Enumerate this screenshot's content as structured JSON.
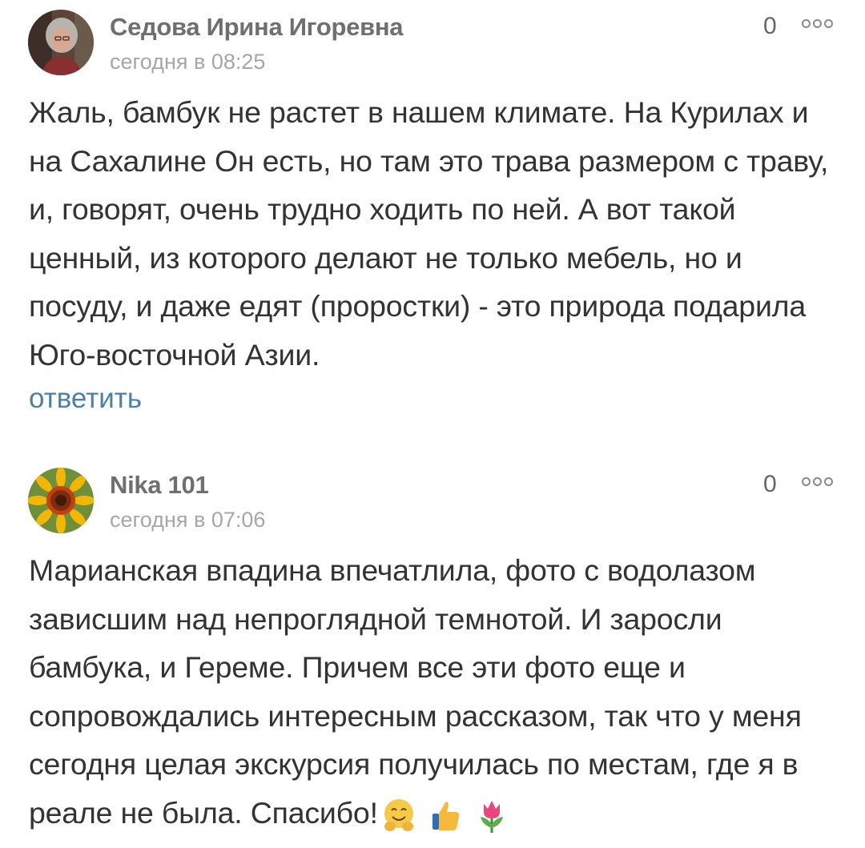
{
  "comments": [
    {
      "author": "Седова Ирина Игоревна",
      "timestamp": "сегодня в 08:25",
      "rating": "0",
      "text": "Жаль, бамбук не растет в нашем климате. На Курилах и на Сахалине Он есть, но там это трава размером с траву, и, говорят, очень трудно ходить по ней. А вот такой ценный, из которого делают не только мебель, но и посуду, и даже едят (проростки) - это природа подарила Юго-восточной Азии.",
      "reply_label": "ответить",
      "avatar_icon": "portrait-photo"
    },
    {
      "author": "Nika 101",
      "timestamp": "сегодня в 07:06",
      "rating": "0",
      "text": "Марианская впадина впечатлила, фото с водолазом зависшим над непроглядной темнотой. И заросли бамбука, и Гереме. Причем все эти фото еще и сопровождались интересным рассказом, так что у меня сегодня целая экскурсия получилась по местам, где я в реале не была. Спасибо!",
      "emojis": [
        "hugging-face-emoji",
        "thumbs-up-emoji",
        "tulip-emoji"
      ],
      "avatar_icon": "sunflower-photo"
    }
  ],
  "colors": {
    "author": "#6f6f6f",
    "timestamp": "#a6a6a6",
    "body_text": "#333333",
    "reply_link": "#4e7fa8"
  }
}
